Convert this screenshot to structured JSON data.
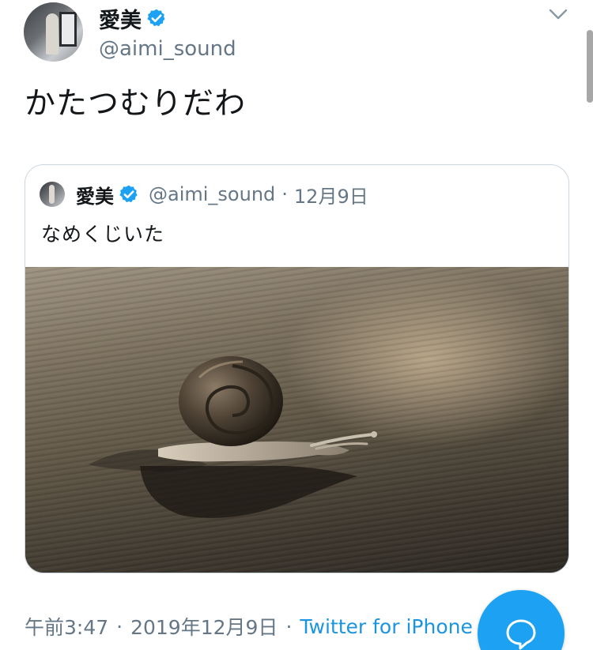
{
  "tweet": {
    "author_name": "愛美",
    "author_handle": "@aimi_sound",
    "text": "かたつむりだわ",
    "timestamp": "午前3:47",
    "date": "2019年12月9日",
    "separator": "·",
    "source": "Twitter for iPhone"
  },
  "quoted": {
    "author_name": "愛美",
    "author_handle": "@aimi_sound",
    "separator": "·",
    "date": "12月9日",
    "text": "なめくじいた"
  },
  "icons": {
    "verified": "verified-badge-icon",
    "chevron": "chevron-down-icon",
    "compose": "speech-bubble-icon"
  },
  "colors": {
    "accent": "#1da1f2",
    "link": "#1b95e0",
    "secondary_text": "#657786",
    "border": "#ccd6dd"
  }
}
